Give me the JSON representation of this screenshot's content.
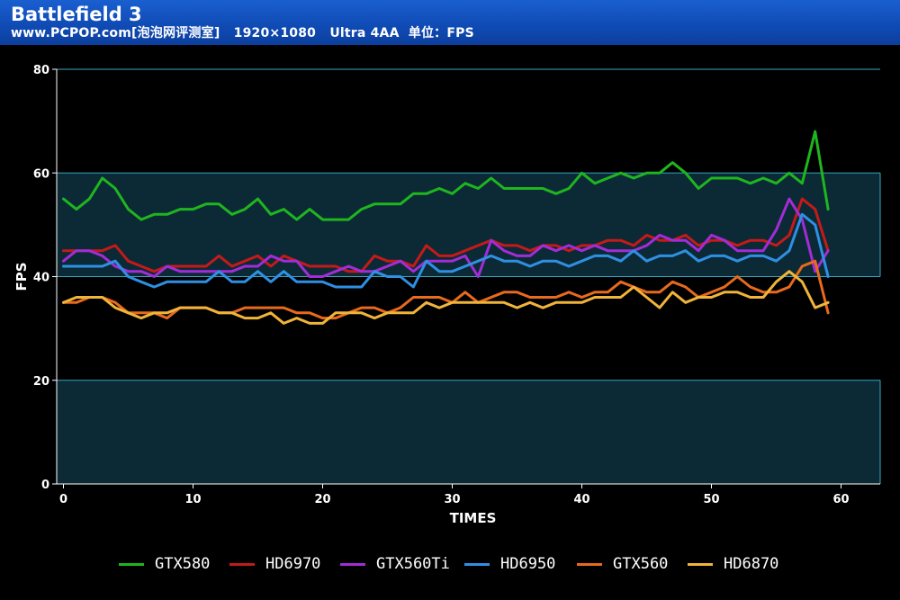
{
  "header": {
    "title": "Battlefield 3",
    "subtitle": "www.PCPOP.com[泡泡网评测室]   1920×1080   Ultra 4AA  单位：FPS"
  },
  "colors": {
    "header_bg": "#1455c4",
    "plot_bg": "#0b2a35",
    "grid": "#3aa6c4",
    "axis_text": "#ffffff"
  },
  "chart_data": {
    "type": "line",
    "title": "Battlefield 3",
    "xlabel": "TIMES",
    "ylabel": "FPS",
    "xlim": [
      0,
      62
    ],
    "ylim": [
      0,
      80
    ],
    "xticks": [
      0,
      10,
      20,
      30,
      40,
      50,
      60
    ],
    "yticks": [
      0,
      20,
      40,
      60,
      80
    ],
    "grid": "horizontal",
    "legend_position": "bottom",
    "x": [
      0,
      1,
      2,
      3,
      4,
      5,
      6,
      7,
      8,
      9,
      10,
      11,
      12,
      13,
      14,
      15,
      16,
      17,
      18,
      19,
      20,
      21,
      22,
      23,
      24,
      25,
      26,
      27,
      28,
      29,
      30,
      31,
      32,
      33,
      34,
      35,
      36,
      37,
      38,
      39,
      40,
      41,
      42,
      43,
      44,
      45,
      46,
      47,
      48,
      49,
      50,
      51,
      52,
      53,
      54,
      55,
      56,
      57,
      58,
      59
    ],
    "series": [
      {
        "name": "GTX580",
        "color": "#1fb51f",
        "values": [
          55,
          53,
          55,
          59,
          57,
          53,
          51,
          52,
          52,
          53,
          53,
          54,
          54,
          52,
          53,
          55,
          52,
          53,
          51,
          53,
          51,
          51,
          51,
          53,
          54,
          54,
          54,
          56,
          56,
          57,
          56,
          58,
          57,
          59,
          57,
          57,
          57,
          57,
          56,
          57,
          60,
          58,
          59,
          60,
          59,
          60,
          60,
          62,
          60,
          57,
          59,
          59,
          59,
          58,
          59,
          58,
          60,
          58,
          68,
          53
        ]
      },
      {
        "name": "HD6970",
        "color": "#c41a1a",
        "values": [
          45,
          45,
          45,
          45,
          46,
          43,
          42,
          41,
          42,
          42,
          42,
          42,
          44,
          42,
          43,
          44,
          42,
          44,
          43,
          42,
          42,
          42,
          41,
          41,
          44,
          43,
          43,
          42,
          46,
          44,
          44,
          45,
          46,
          47,
          46,
          46,
          45,
          46,
          46,
          45,
          46,
          46,
          47,
          47,
          46,
          48,
          47,
          47,
          48,
          46,
          47,
          47,
          46,
          47,
          47,
          46,
          48,
          55,
          53,
          45
        ]
      },
      {
        "name": "GTX560Ti",
        "color": "#a22cd6",
        "values": [
          43,
          45,
          45,
          44,
          42,
          41,
          41,
          40,
          42,
          41,
          41,
          41,
          41,
          41,
          42,
          42,
          44,
          43,
          43,
          40,
          40,
          41,
          42,
          41,
          41,
          42,
          43,
          41,
          43,
          43,
          43,
          44,
          40,
          47,
          45,
          44,
          44,
          46,
          45,
          46,
          45,
          46,
          45,
          45,
          45,
          46,
          48,
          47,
          47,
          45,
          48,
          47,
          45,
          45,
          45,
          49,
          55,
          51,
          41,
          45
        ]
      },
      {
        "name": "HD6950",
        "color": "#2f8fe3",
        "values": [
          42,
          42,
          42,
          42,
          43,
          40,
          39,
          38,
          39,
          39,
          39,
          39,
          41,
          39,
          39,
          41,
          39,
          41,
          39,
          39,
          39,
          38,
          38,
          38,
          41,
          40,
          40,
          38,
          43,
          41,
          41,
          42,
          43,
          44,
          43,
          43,
          42,
          43,
          43,
          42,
          43,
          44,
          44,
          43,
          45,
          43,
          44,
          44,
          45,
          43,
          44,
          44,
          43,
          44,
          44,
          43,
          45,
          52,
          50,
          40
        ]
      },
      {
        "name": "GTX560",
        "color": "#e86a1c",
        "values": [
          35,
          35,
          36,
          36,
          35,
          33,
          33,
          33,
          32,
          34,
          34,
          34,
          33,
          33,
          34,
          34,
          34,
          34,
          33,
          33,
          32,
          32,
          33,
          34,
          34,
          33,
          34,
          36,
          36,
          36,
          35,
          37,
          35,
          36,
          37,
          37,
          36,
          36,
          36,
          37,
          36,
          37,
          37,
          39,
          38,
          37,
          37,
          39,
          38,
          36,
          37,
          38,
          40,
          38,
          37,
          37,
          38,
          42,
          43,
          33
        ]
      },
      {
        "name": "HD6870",
        "color": "#f0b43a",
        "values": [
          35,
          36,
          36,
          36,
          34,
          33,
          32,
          33,
          33,
          34,
          34,
          34,
          33,
          33,
          32,
          32,
          33,
          31,
          32,
          31,
          31,
          33,
          33,
          33,
          32,
          33,
          33,
          33,
          35,
          34,
          35,
          35,
          35,
          35,
          35,
          34,
          35,
          34,
          35,
          35,
          35,
          36,
          36,
          36,
          38,
          36,
          34,
          37,
          35,
          36,
          36,
          37,
          37,
          36,
          36,
          39,
          41,
          39,
          34,
          35
        ]
      }
    ]
  }
}
